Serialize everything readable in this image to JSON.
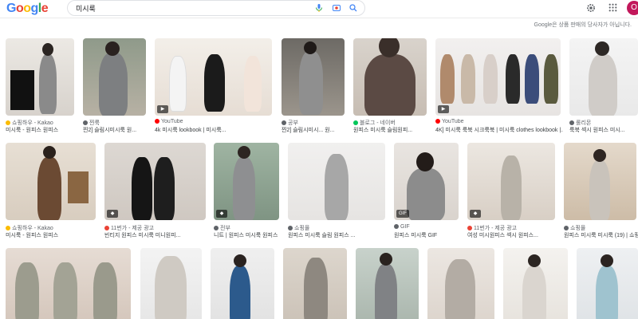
{
  "header": {
    "logo": [
      "G",
      "o",
      "o",
      "g",
      "l",
      "e"
    ],
    "logo_colors": [
      "#4285f4",
      "#ea4335",
      "#fbbc05",
      "#4285f4",
      "#34a853",
      "#ea4335"
    ],
    "search_value": "미시룩",
    "avatar_letter": "O",
    "notice": "Google은 상품 판매의 당사자가 아닙니다."
  },
  "icons": {
    "mic": "🎤",
    "lens": "◉",
    "search": "🔍",
    "gear": "⚙",
    "apps": "⋮⋮⋮"
  },
  "row1": [
    {
      "src": "쇼핑하우 - Kakao",
      "title": "미시룩 - 원피스 원피스"
    },
    {
      "src": "찐룩",
      "title": "찐2] 슬림시미시룩 원..."
    },
    {
      "src": "YouTube",
      "title": "4k 미시룩 lookbook | 미시룩..."
    },
    {
      "src": "공부",
      "title": "찐2] 슬림시미시... 원..."
    },
    {
      "src": "블로그 - 네이버",
      "title": "원피스 미시룩 슬림원피..."
    },
    {
      "src": "YouTube",
      "title": "4K] 미시룩 룩북 시크룩북 | 미시룩 clothes lookbook |..."
    },
    {
      "src": "롤리몬",
      "title": "룩북 섹시 원피스 미시..."
    }
  ],
  "row2": [
    {
      "src": "쇼핑하우 - Kakao",
      "title": "미시룩 - 원피스 원피스"
    },
    {
      "src": "11번가 - 제공 광고",
      "title": "빈티지 원피스 미시룩 미니원피..."
    },
    {
      "src": "전부",
      "title": "니트 | 원피스 미시룩 원피스"
    },
    {
      "src": "쇼핑몰",
      "title": "원피스 미시룩 슬림 원피스 ..."
    },
    {
      "src": "GIF",
      "title": "원피스 미시룩 GIF"
    },
    {
      "src": "11번가 - 제공 광고",
      "title": "여성 미시원피스 섹시 원피스..."
    },
    {
      "src": "쇼핑몰",
      "title": "원피스 미시룩 미시룩 (19) | 쇼핑몰"
    }
  ],
  "badges": {
    "play": "▶",
    "gif": "GIF",
    "tag": "◆"
  }
}
